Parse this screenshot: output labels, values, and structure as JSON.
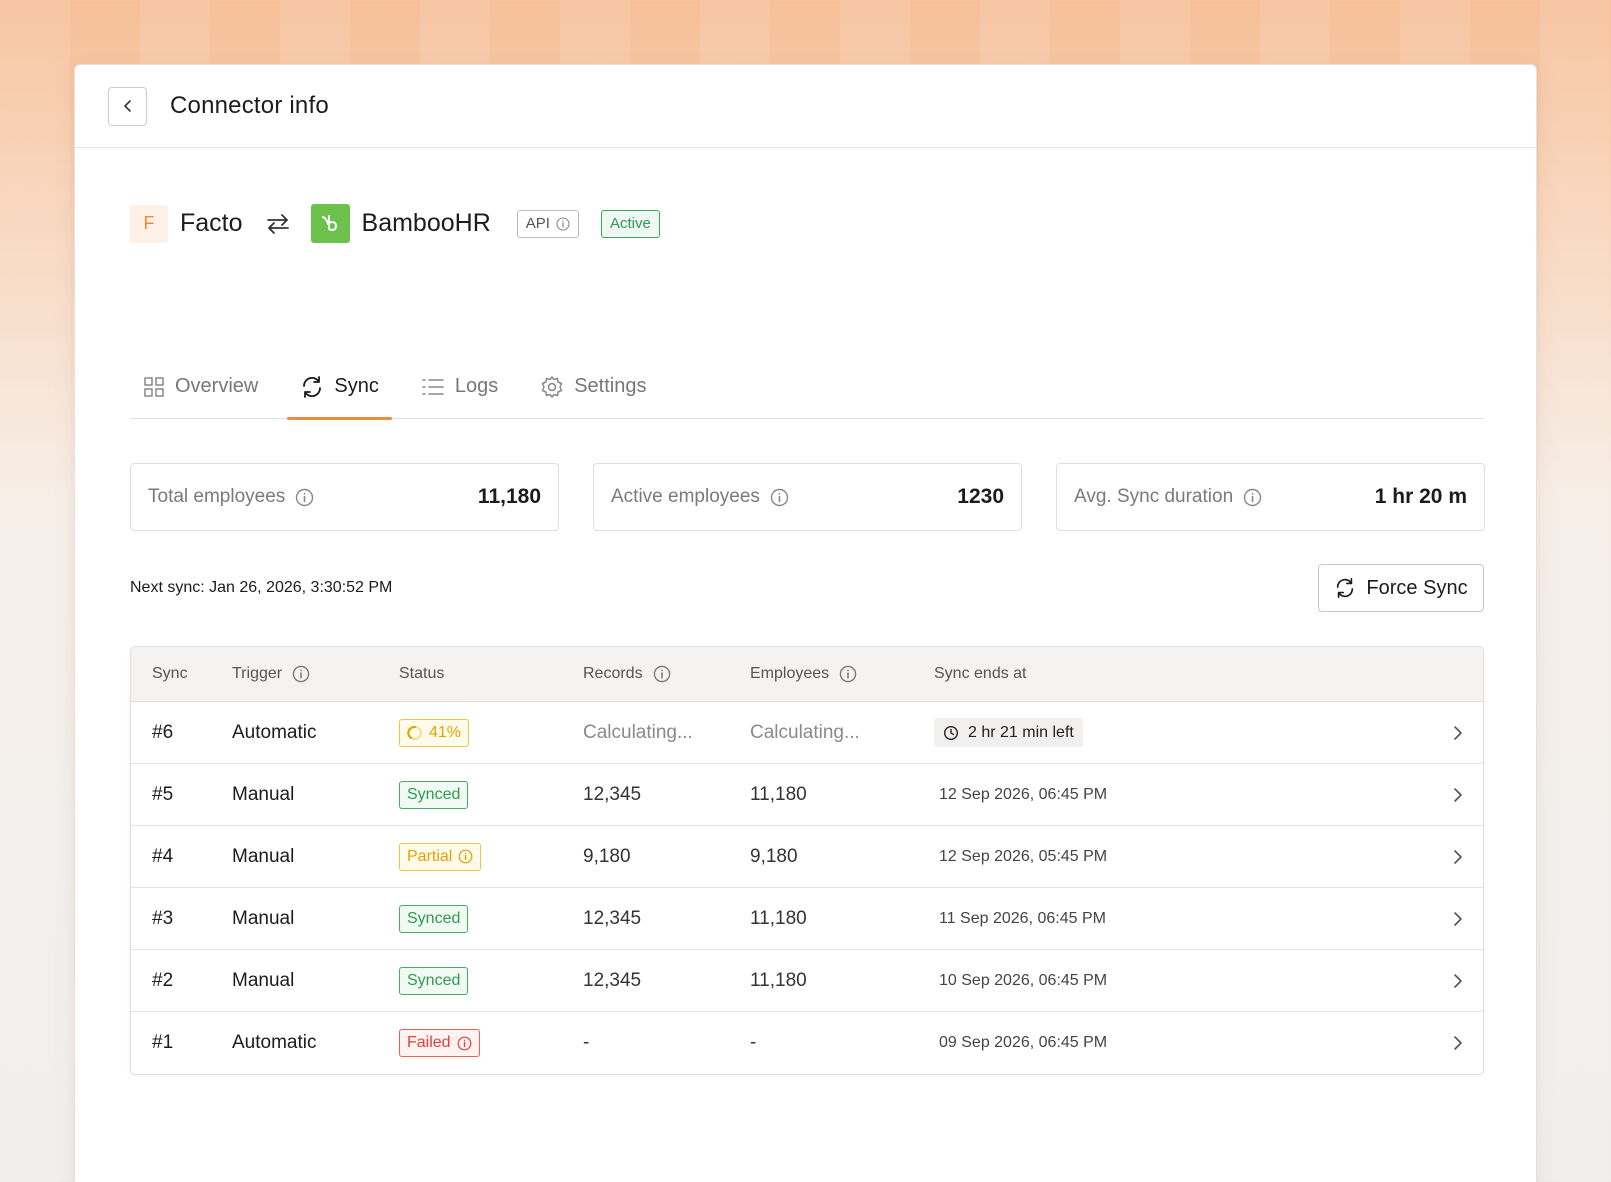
{
  "header": {
    "title": "Connector info"
  },
  "connector": {
    "source_logo_letter": "F",
    "source_name": "Facto",
    "target_name": "BambooHR",
    "api_label": "API",
    "status_label": "Active",
    "colors": {
      "accent": "#f08a3c",
      "bamboo": "#6cc24a",
      "active": "#2e9a52"
    }
  },
  "tabs": [
    {
      "label": "Overview",
      "icon": "grid-icon"
    },
    {
      "label": "Sync",
      "icon": "sync-icon",
      "active": true
    },
    {
      "label": "Logs",
      "icon": "list-icon"
    },
    {
      "label": "Settings",
      "icon": "gear-icon"
    }
  ],
  "stats": [
    {
      "label": "Total employees",
      "value": "11,180"
    },
    {
      "label": "Active employees",
      "value": "1230"
    },
    {
      "label": "Avg. Sync duration",
      "value": "1 hr 20 m"
    }
  ],
  "next_sync": "Next sync: Jan 26, 2026, 3:30:52 PM",
  "force_sync_label": "Force Sync",
  "table": {
    "headers": [
      "Sync",
      "Trigger",
      "Status",
      "Records",
      "Employees",
      "Sync ends at"
    ],
    "rows": [
      {
        "sync": "#6",
        "trigger": "Automatic",
        "status": "41%",
        "status_type": "progress",
        "records": "Calculating...",
        "employees": "Calculating...",
        "ends": "2 hr 21 min left"
      },
      {
        "sync": "#5",
        "trigger": "Manual",
        "status": "Synced",
        "status_type": "synced",
        "records": "12,345",
        "employees": "11,180",
        "ends": "12 Sep 2026, 06:45 PM"
      },
      {
        "sync": "#4",
        "trigger": "Manual",
        "status": "Partial",
        "status_type": "partial",
        "records": "9,180",
        "employees": "9,180",
        "ends": "12 Sep 2026, 05:45 PM"
      },
      {
        "sync": "#3",
        "trigger": "Manual",
        "status": "Synced",
        "status_type": "synced",
        "records": "12,345",
        "employees": "11,180",
        "ends": "11 Sep 2026, 06:45 PM"
      },
      {
        "sync": "#2",
        "trigger": "Manual",
        "status": "Synced",
        "status_type": "synced",
        "records": "12,345",
        "employees": "11,180",
        "ends": "10 Sep 2026, 06:45 PM"
      },
      {
        "sync": "#1",
        "trigger": "Automatic",
        "status": "Failed",
        "status_type": "failed",
        "records": "-",
        "employees": "-",
        "ends": "09 Sep 2026, 06:45 PM"
      }
    ]
  }
}
